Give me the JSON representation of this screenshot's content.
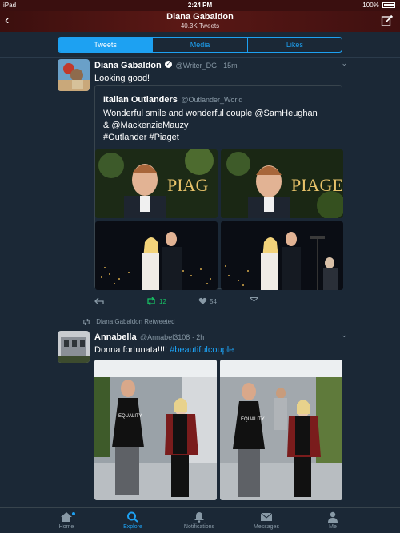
{
  "status": {
    "device": "iPad",
    "time": "2:24 PM",
    "battery": "100%"
  },
  "header": {
    "title": "Diana Gabaldon",
    "subtitle": "40.3K Tweets"
  },
  "tabs": [
    {
      "label": "Tweets",
      "active": true
    },
    {
      "label": "Media",
      "active": false
    },
    {
      "label": "Likes",
      "active": false
    }
  ],
  "tweet1": {
    "name": "Diana Gabaldon",
    "handle": "@Writer_DG · 15m",
    "text": "Looking good!",
    "quote": {
      "name": "Italian Outlanders",
      "handle": "@Outlander_World",
      "line1": "Wonderful smile and wonderful couple @SamHeughan",
      "line2": "& @MackenzieMauzy",
      "line3": "#Outlander #Piaget"
    },
    "retweets": "12",
    "likes": "54"
  },
  "tweet2": {
    "retweeted_by": "Diana Gabaldon Retweeted",
    "name": "Annabella",
    "handle": "@Annabel3108 · 2h",
    "text": "Donna fortunata!!!! ",
    "hashtag": "#beautifulcouple"
  },
  "bottom": {
    "home": "Home",
    "explore": "Explore",
    "notifications": "Notifications",
    "messages": "Messages",
    "me": "Me"
  },
  "colors": {
    "accent": "#1da1f2",
    "retweet_green": "#17bf63",
    "background": "#1b2836",
    "header": "#4a1412"
  }
}
